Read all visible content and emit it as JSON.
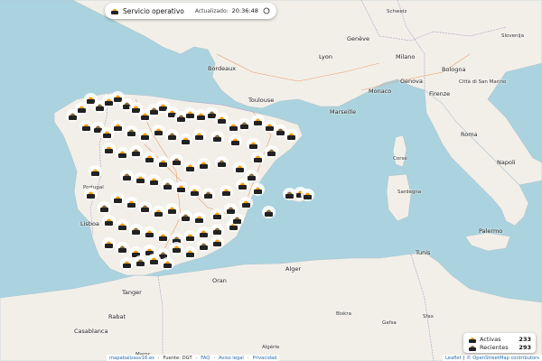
{
  "status": {
    "service_label": "Servicio operativo",
    "updated_label": "Actualizado:",
    "updated_time": "20:36:48"
  },
  "legend": {
    "active_label": "Activas",
    "active_count": "233",
    "recent_label": "Recientes",
    "recent_count": "293"
  },
  "footer": {
    "site": "mapabalizasv16.es",
    "source": "Fuente: DGT",
    "faq": "FAQ",
    "legal": "Aviso legal",
    "privacy": "Privacidad"
  },
  "attribution": {
    "leaflet": "Leaflet",
    "osm": "© OpenStreetMap contributors"
  },
  "map_labels": {
    "bordeaux": "Bordeaux",
    "toulouse": "Toulouse",
    "marseille": "Marseille",
    "monaco": "Monaco",
    "genova": "Genova",
    "milano": "Milano",
    "bologna": "Bologna",
    "firenze": "Firenze",
    "roma": "Roma",
    "napoli": "Napoli",
    "palermo": "Palermo",
    "lyon": "Lyon",
    "geneve": "Genève",
    "schweiz": "Schweiz",
    "slovenija": "Slovenija",
    "sanmarino": "Città di San Marino",
    "portugal": "Portugal",
    "lisboa": "Lisboa",
    "tanger": "Tanger",
    "rabat": "Rabat",
    "casablanca": "Casablanca",
    "oran": "Oran",
    "alger": "Alger",
    "tunis": "Tunis",
    "biskra": "Biskra",
    "gafsa": "Gafsa",
    "sfax": "Sfax",
    "sardegna": "Sardegna",
    "corse": "Corse",
    "algerie": "Algérie",
    "maroc": "Maroc"
  },
  "colors": {
    "sea": "#aad3df",
    "land": "#f2efe9",
    "marker_body": "#222222",
    "marker_light": "#f39c12"
  }
}
